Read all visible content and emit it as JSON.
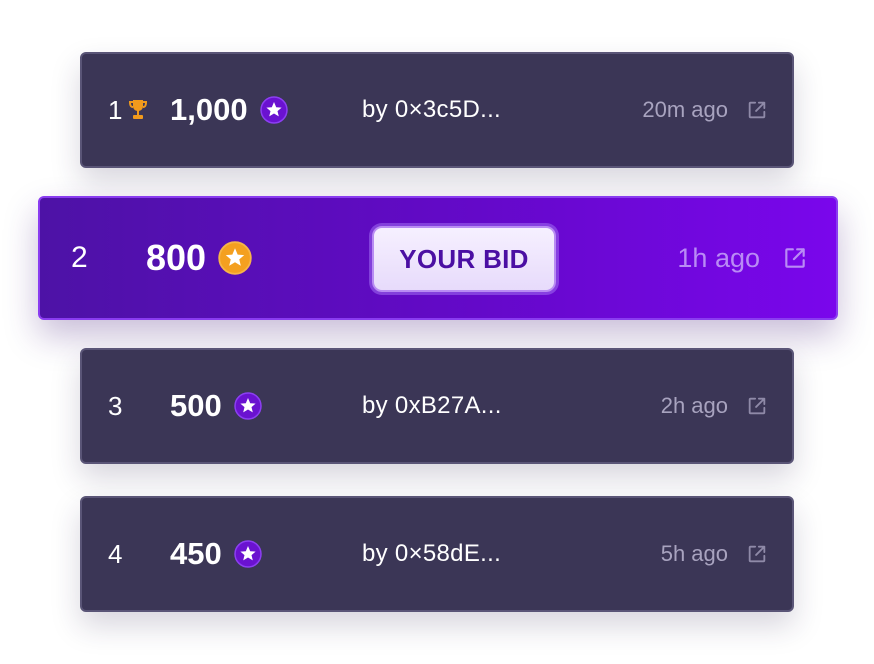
{
  "bids": [
    {
      "rank": "1",
      "amount": "1,000",
      "bidder": "by 0×3c5D...",
      "time": "20m ago",
      "is_top": true
    },
    {
      "rank": "2",
      "amount": "800",
      "badge": "YOUR BID",
      "time": "1h ago",
      "is_mine": true
    },
    {
      "rank": "3",
      "amount": "500",
      "bidder": "by 0xB27A...",
      "time": "2h ago"
    },
    {
      "rank": "4",
      "amount": "450",
      "bidder": "by 0×58dE...",
      "time": "5h ago"
    }
  ],
  "colors": {
    "row_background": "#3b3656",
    "highlight_gradient_start": "#4d12a6",
    "highlight_gradient_end": "#7a06ec",
    "coin_purple": "#6a12d0",
    "coin_orange": "#f4a020",
    "trophy_orange": "#f19a1c",
    "muted_text": "#a8a3bf"
  },
  "icons": {
    "trophy": "trophy-icon",
    "coin": "star-coin-icon",
    "external": "external-link-icon"
  }
}
